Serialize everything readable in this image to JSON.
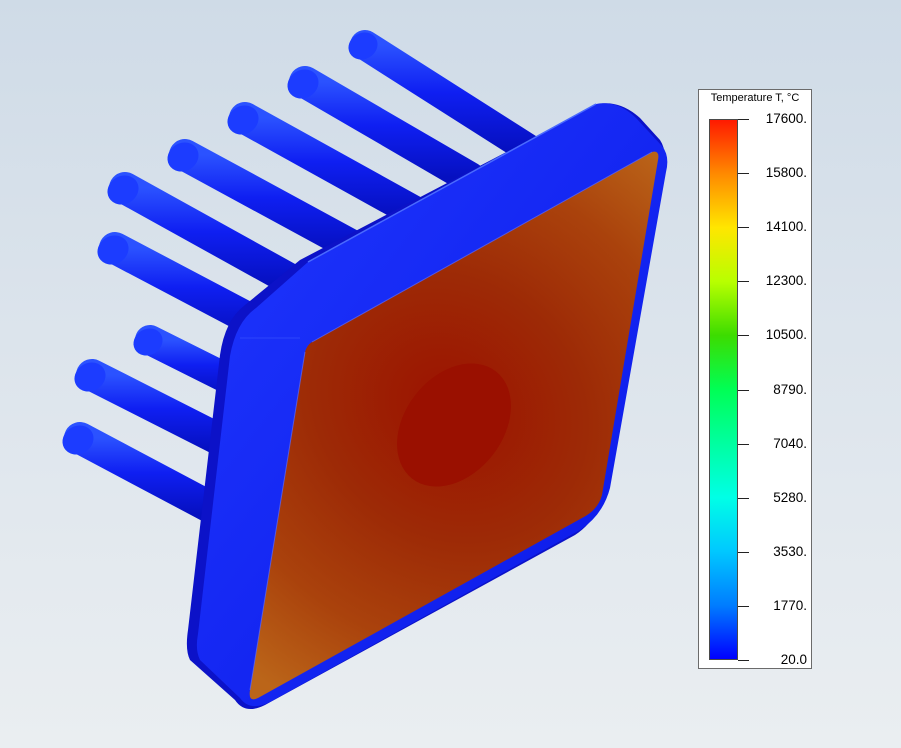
{
  "legend": {
    "title": "Temperature T, °C",
    "ticks": [
      "17600.",
      "15800.",
      "14100.",
      "12300.",
      "10500.",
      "8790.",
      "7040.",
      "5280.",
      "3530.",
      "1770.",
      "20.0"
    ],
    "colors": [
      "#ff1a00",
      "#ff8a00",
      "#ffe600",
      "#b8ff00",
      "#3cdc00",
      "#00ff55",
      "#00ffa0",
      "#00ffe6",
      "#00c8ff",
      "#007dff",
      "#0000ff"
    ]
  },
  "model": {
    "body_color": "#0a14f0",
    "face_colors": [
      "#9c1200",
      "#a8390b",
      "#b9601a"
    ]
  }
}
